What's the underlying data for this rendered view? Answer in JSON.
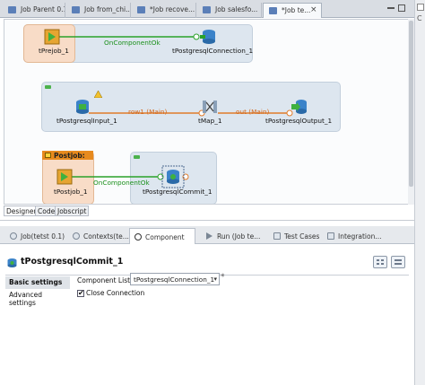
{
  "editor_tabs": [
    {
      "label": "Job Parent 0.1",
      "active": false
    },
    {
      "label": "Job from_chi...",
      "active": false
    },
    {
      "label": "*Job recove...",
      "active": false
    },
    {
      "label": "Job salesfo...",
      "active": false
    },
    {
      "label": "*Job te...",
      "active": true
    }
  ],
  "editor_tab_close": "×",
  "right_strip_text": "C",
  "designer": {
    "subjobs": [
      {
        "components": [
          "tPrejob_1",
          "tPostgresqlConnection_1"
        ],
        "link_label": "OnComponentOk"
      },
      {
        "components": [
          "tPostgresqlInput_1",
          "tMap_1",
          "tPostgresqlOutput_1"
        ],
        "links": [
          "row1 (Main)",
          "out (Main)"
        ]
      },
      {
        "title": "Postjob:",
        "components": [
          "tPostjob_1",
          "tPostgresqlCommit_1"
        ],
        "link_label": "OnComponentOk"
      }
    ],
    "tabs": [
      "Designer",
      "Code",
      "Jobscript"
    ],
    "active_tab": "Designer"
  },
  "view_tabs": [
    {
      "label": "Job(tetst 0.1)",
      "active": false
    },
    {
      "label": "Contexts(te...",
      "active": false
    },
    {
      "label": "Component",
      "active": true
    },
    {
      "label": "Run (Job te...",
      "active": false
    },
    {
      "label": "Test Cases",
      "active": false
    },
    {
      "label": "Integration...",
      "active": false
    }
  ],
  "component_view": {
    "title": "tPostgresqlCommit_1",
    "nav": [
      "Basic settings",
      "Advanced settings"
    ],
    "active_nav": "Basic settings",
    "component_list_label": "Component List",
    "component_list_value": "tPostgresqlConnection_1",
    "required_marker": "*",
    "close_connection_label": "Close Connection",
    "close_connection_checked": true,
    "check_mark": "✔",
    "dropdown_caret": "▾"
  },
  "colors": {
    "trigger_link": "#2aa22a",
    "row_link": "#e07b2a",
    "postjob_header": "#e78a1e"
  }
}
